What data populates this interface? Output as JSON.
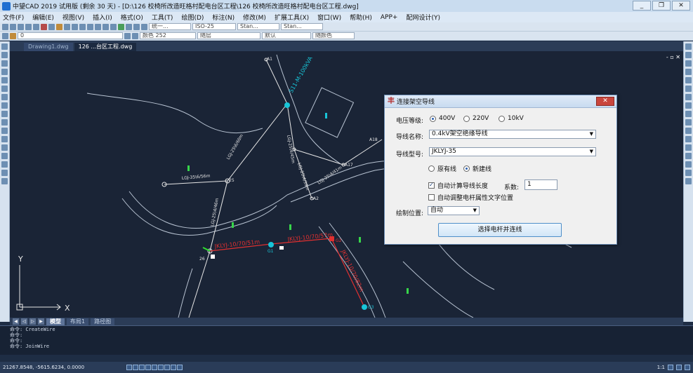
{
  "app": {
    "title": "中望CAD 2019 试用版 (剩余 30 天) - [D:\\126 校椅所改造旺格村配电台区工程\\126 校椅所改造旺格村配电台区工程.dwg]",
    "window_buttons": [
      "_",
      "❐",
      "✕"
    ]
  },
  "menu": [
    "文件(F)",
    "编辑(E)",
    "视图(V)",
    "插入(I)",
    "格式(O)",
    "工具(T)",
    "绘图(D)",
    "标注(N)",
    "修改(M)",
    "扩展工具(X)",
    "窗口(W)",
    "帮助(H)",
    "APP+",
    "配网设计(Y)"
  ],
  "toolbar2": {
    "layer": "0",
    "color": "颜色 252",
    "linetype": "随层",
    "lineweight": "默认",
    "plotstyle": "随颜色",
    "style1": "统一...",
    "dimstyle": "ISO-25",
    "textstyle": "Stan...",
    "tablestyle": "Stan..."
  },
  "doc_tabs": [
    "Drawing1.dwg",
    "126 ...台区工程.dwg"
  ],
  "canvas": {
    "controls": "- ▫ ✕",
    "labels": {
      "a1": "A1",
      "a2": "A2",
      "a17": "A17",
      "a18": "A18",
      "a25": "25",
      "a26": "26",
      "g1": "G1",
      "g2": "G2",
      "g3": "G3",
      "w1": "LGJ-35\\6/56m",
      "w2": "LGJ-25\\6/60m",
      "w3": "JKLYJ-10/70/51m",
      "w4": "JKLYJ-10/70/82m",
      "w5": "JKLYJ-10/70/57m",
      "w6": "LGJ-25\\4/46m",
      "w7": "LGJ-25\\4/45m",
      "w8": "LGJ-25\\4/39m",
      "w9": "LGJ-25\\4/41m",
      "trans": "S11-M-100kVA",
      "axis_y": "Y",
      "axis_x": "X"
    }
  },
  "layout_tabs": [
    "模型",
    "布局1",
    "路径图"
  ],
  "cmdline": [
    "命令: CreateWire",
    "命令:",
    "命令:",
    "命令: JoinWire"
  ],
  "status": {
    "coords": "21267.8548, -5615.6234, 0.0000",
    "scale": "1:1"
  },
  "dialog": {
    "title": "连接架空导线",
    "voltage_label": "电压等级:",
    "voltage_options": [
      "400V",
      "220V",
      "10kV"
    ],
    "voltage_selected": "400V",
    "wire_name_label": "导线名称:",
    "wire_name": "0.4kV架空绝缘导线",
    "wire_model_label": "导线型号:",
    "wire_model": "JKLYJ-35",
    "line_type_options": [
      "原有线",
      "新建线"
    ],
    "line_type_selected": "新建线",
    "auto_length_label": "自动计算导线长度",
    "auto_length_checked": true,
    "coef_label": "系数:",
    "coef_value": "1",
    "auto_adjust_label": "自动调整电杆属性文字位置",
    "auto_adjust_checked": false,
    "draw_pos_label": "绘制位置:",
    "draw_pos": "自动",
    "action_button": "选择电杆并连线"
  }
}
